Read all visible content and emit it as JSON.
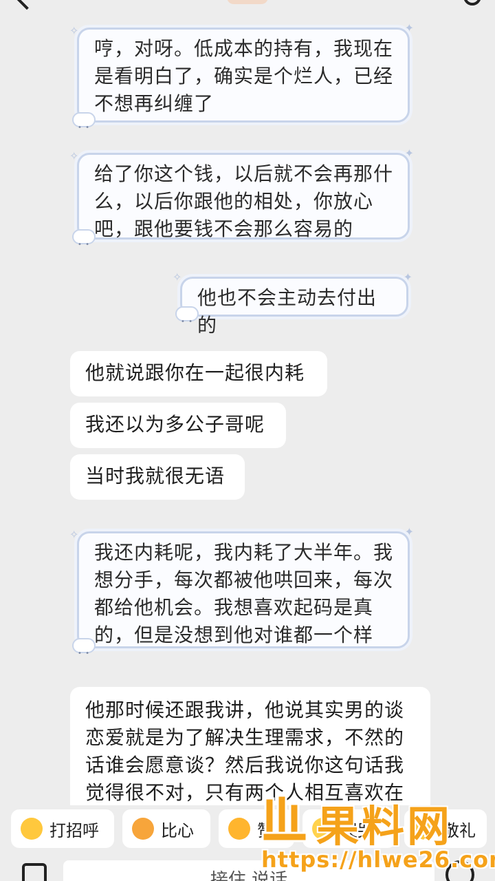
{
  "messages": [
    {
      "side": "right-styled",
      "text": "哼，对呀。低成本的持有，我现在是看明白了，确实是个烂人，已经不想再纠缠了"
    },
    {
      "side": "right-styled",
      "text": "给了你这个钱，以后就不会再那什么，以后你跟他的相处，你放心吧，跟他要钱不会那么容易的"
    },
    {
      "side": "right-styled",
      "text": "他也不会主动去付出的"
    },
    {
      "side": "left",
      "text": "他就说跟你在一起很内耗"
    },
    {
      "side": "left",
      "text": "我还以为多公子哥呢"
    },
    {
      "side": "left",
      "text": "当时我就很无语"
    },
    {
      "side": "right-styled",
      "text": "我还内耗呢，我内耗了大半年。我想分手，每次都被他哄回来，每次都给他机会。我想喜欢起码是真的，但是没想到他对谁都一个样"
    },
    {
      "side": "left",
      "text": "他那时候还跟我讲，他说其实男的谈恋爱就是为了解决生理需求，不然的话谁会愿意谈？然后我说你这句话我觉得很不对，只有两个人相互喜欢在"
    }
  ],
  "quick_replies": [
    {
      "label": "打招呼",
      "icon": "wave-emoji-icon"
    },
    {
      "label": "比心",
      "icon": "heart-hands-emoji-icon"
    },
    {
      "label": "赞",
      "icon": "thumbs-up-emoji-icon"
    },
    {
      "label": "哭哭",
      "icon": "crying-emoji-icon"
    },
    {
      "label": "敬礼",
      "icon": "salute-emoji-icon"
    }
  ],
  "input": {
    "placeholder": "接住 说话"
  },
  "watermark": {
    "brand": "果料网",
    "url": "https://hlwe26.com"
  },
  "colors": {
    "background": "#ededed",
    "styled_bubble_border": "#c8d4ea",
    "watermark": "#f5a21a"
  }
}
